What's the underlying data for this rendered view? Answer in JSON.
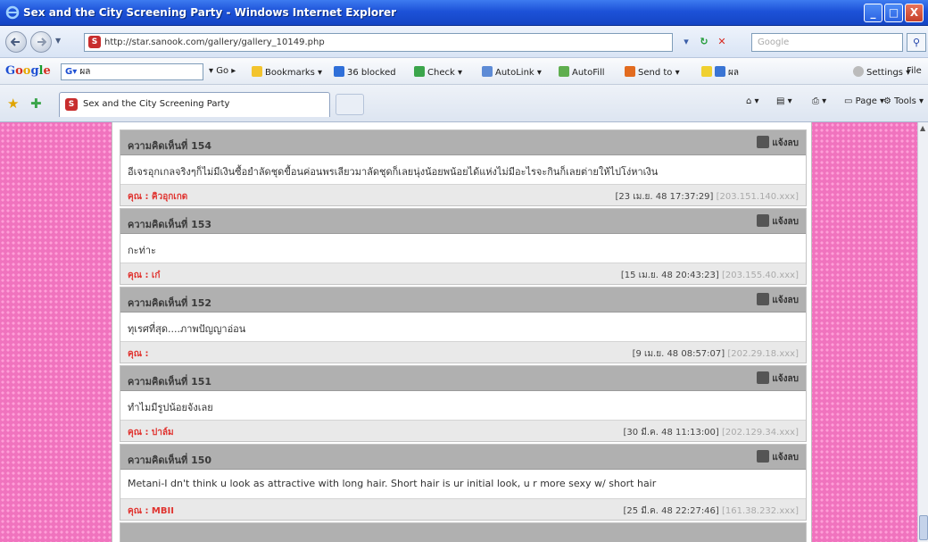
{
  "window": {
    "title": "Sex and the City Screening Party - Windows Internet Explorer",
    "minimize": "_",
    "maximize": "□",
    "close": "X"
  },
  "address_bar": {
    "url": "http://star.sanook.com/gallery/gallery_10149.php",
    "search_placeholder": "Google"
  },
  "google_toolbar": {
    "search_value": "ผล",
    "go_label": "Go",
    "bookmarks_label": "Bookmarks",
    "blocked_label": "36 blocked",
    "check_label": "Check",
    "autolink_label": "AutoLink",
    "autofill_label": "AutoFill",
    "sendto_label": "Send to",
    "highlight_label": "ผล",
    "settings_label": "Settings",
    "file_label": "File"
  },
  "tabs": [
    {
      "label": "Sex and the City Screening Party"
    }
  ],
  "command_bar": {
    "page_label": "Page",
    "tools_label": "Tools"
  },
  "comments": [
    {
      "number": "ความคิดเห็นที่ 154",
      "report": "แจ้งลบ",
      "text": "อีเจรอุกเกลจริงๆก็ไม่มีเงินซื้อยำลัดชุดขื้อนค่อนพรเลียวมาลัดชุดก็เลยนุ่งน้อยพน้อยได้แห่งไม่มีอะไรจะกินก็เลยต่ายให้ไปโง่หาเงิน",
      "author": "คุณ : คิวอุกเกด",
      "datetime": "[23 เม.ย. 48 17:37:29]",
      "ip": "[203.151.140.xxx]"
    },
    {
      "number": "ความคิดเห็นที่ 153",
      "report": "แจ้งลบ",
      "text": "กะท่าะ",
      "author": "คุณ : เก๋",
      "datetime": "[15 เม.ย. 48 20:43:23]",
      "ip": "[203.155.40.xxx]"
    },
    {
      "number": "ความคิดเห็นที่ 152",
      "report": "แจ้งลบ",
      "text": "ทุเรศที่สุด....ภาพปัญญาอ่อน",
      "author": "คุณ :",
      "datetime": "[9 เม.ย. 48 08:57:07]",
      "ip": "[202.29.18.xxx]"
    },
    {
      "number": "ความคิดเห็นที่ 151",
      "report": "แจ้งลบ",
      "text": "ทำไมมีรูปน้อยจังเลย",
      "author": "คุณ : ปาล์ม",
      "datetime": "[30 มี.ค. 48 11:13:00]",
      "ip": "[202.129.34.xxx]"
    },
    {
      "number": "ความคิดเห็นที่ 150",
      "report": "แจ้งลบ",
      "text": "Metani-I dn't think u look as attractive with long hair. Short hair is ur initial look, u r more sexy w/ short hair",
      "author": "คุณ : MBII",
      "datetime": "[25 มี.ค. 48 22:27:46]",
      "ip": "[161.38.232.xxx]"
    }
  ]
}
